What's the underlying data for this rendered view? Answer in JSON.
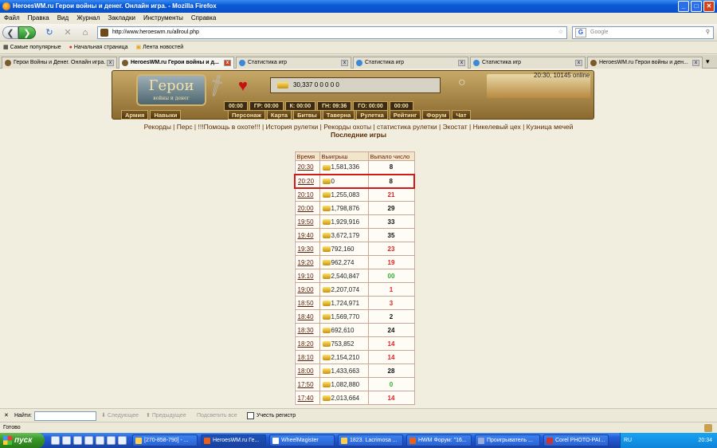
{
  "window": {
    "title": "HeroesWM.ru Герои войны и денег. Онлайн игра. - Mozilla Firefox"
  },
  "menu": [
    "Файл",
    "Правка",
    "Вид",
    "Журнал",
    "Закладки",
    "Инструменты",
    "Справка"
  ],
  "nav": {
    "url": "http://www.heroeswm.ru/allroul.php",
    "search_placeholder": "Google"
  },
  "bookmarks": [
    "Самые популярные",
    "Начальная страница",
    "Лента новостей"
  ],
  "tabs": [
    {
      "label": "Герои Войны и Денег. Онлайн игра.",
      "active": false
    },
    {
      "label": "HeroesWM.ru Герои войны и д...",
      "active": true
    },
    {
      "label": "Статистика игр",
      "active": false
    },
    {
      "label": "Статистика игр",
      "active": false
    },
    {
      "label": "Статистика игр",
      "active": false
    },
    {
      "label": "HeroesWM.ru Герои войны и ден...",
      "active": false
    }
  ],
  "game": {
    "logo_main": "Герои",
    "logo_sub": "войны и денег",
    "resources": "30,337  0  0  0  0  0",
    "timers": [
      "00:00",
      "ГР: 00:00",
      "К: 00:00",
      "ГН: 09:36",
      "ГО: 00:00",
      "00:00"
    ],
    "online": "20:30, 10145 online",
    "left_nav": [
      "Армия",
      "Навыки"
    ],
    "main_nav": [
      "Персонаж",
      "Карта",
      "Битвы",
      "Таверна",
      "Рулетка",
      "Рейтинг",
      "Форум",
      "Чат"
    ],
    "links": "Рекорды | Перс | !!!Помощь в охоте!!! | История рулетки | Рекорды охоты | статистика рулетки | Экостат | Никелевый цех | Кузница мечей",
    "page_title": "Последние игры"
  },
  "table": {
    "headers": [
      "Время",
      "Выигрыш",
      "Выпало число"
    ],
    "rows": [
      {
        "time": "20:30",
        "win": "1,581,336",
        "num": "8",
        "color": "black"
      },
      {
        "time": "20:20",
        "win": "0",
        "num": "8",
        "color": "black",
        "highlight": true
      },
      {
        "time": "20:10",
        "win": "1,255,083",
        "num": "21",
        "color": "red"
      },
      {
        "time": "20:00",
        "win": "1,798,876",
        "num": "29",
        "color": "black"
      },
      {
        "time": "19:50",
        "win": "1,929,916",
        "num": "33",
        "color": "black"
      },
      {
        "time": "19:40",
        "win": "3,672,179",
        "num": "35",
        "color": "black"
      },
      {
        "time": "19:30",
        "win": "792,160",
        "num": "23",
        "color": "red"
      },
      {
        "time": "19:20",
        "win": "962,274",
        "num": "19",
        "color": "red"
      },
      {
        "time": "19:10",
        "win": "2,540,847",
        "num": "00",
        "color": "green"
      },
      {
        "time": "19:00",
        "win": "2,207,074",
        "num": "1",
        "color": "red"
      },
      {
        "time": "18:50",
        "win": "1,724,971",
        "num": "3",
        "color": "red"
      },
      {
        "time": "18:40",
        "win": "1,569,770",
        "num": "2",
        "color": "black"
      },
      {
        "time": "18:30",
        "win": "692,610",
        "num": "24",
        "color": "black"
      },
      {
        "time": "18:20",
        "win": "753,852",
        "num": "14",
        "color": "red"
      },
      {
        "time": "18:10",
        "win": "2,154,210",
        "num": "14",
        "color": "red"
      },
      {
        "time": "18:00",
        "win": "1,433,663",
        "num": "28",
        "color": "black"
      },
      {
        "time": "17:50",
        "win": "1,082,880",
        "num": "0",
        "color": "green"
      },
      {
        "time": "17:40",
        "win": "2,013,664",
        "num": "14",
        "color": "red"
      }
    ]
  },
  "findbar": {
    "label": "Найти:",
    "next": "Следующее",
    "prev": "Предыдущее",
    "highlight": "Подсветить все",
    "match_case": "Учесть регистр"
  },
  "status": "Готово",
  "taskbar": {
    "start": "пуск",
    "tasks": [
      "[270-858-790] - ...",
      "HeroesWM.ru Ге...",
      "WheelMagister",
      "1823. Lacrimosa ...",
      "HWM Форум: \"16...",
      "Проигрыватель ...",
      "Corel PHOTO-PAI..."
    ],
    "lang": "RU",
    "clock": "20:34"
  }
}
